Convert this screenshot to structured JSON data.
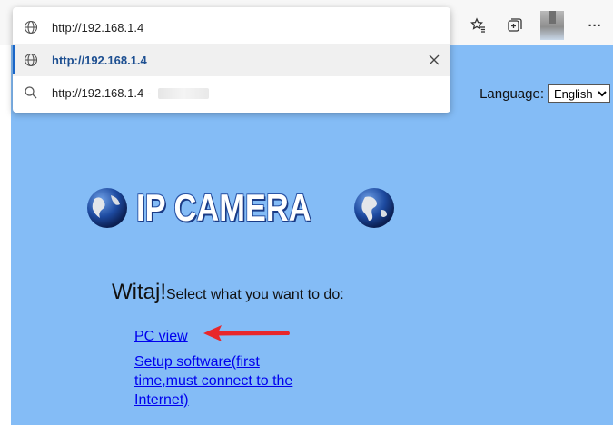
{
  "browser": {
    "favorites_icon": "favorites-star-icon",
    "collections_icon": "collections-icon",
    "more_icon": "more-dots-icon",
    "more_label": "···"
  },
  "address_dropdown": {
    "input_value": "http://192.168.1.4",
    "suggestion_url": "http://192.168.1.4",
    "search_suggestion": "http://192.168.1.4 -"
  },
  "page": {
    "language_label": "Language:",
    "language_selected": "English",
    "language_options": [
      "English"
    ],
    "banner_title": "IP CAMERA",
    "greeting": "Witaj!",
    "prompt": "Select what you want to do:",
    "links": {
      "pc_view": "PC view",
      "setup_software": "Setup software(first time,must connect to the Internet)"
    }
  },
  "colors": {
    "page_background": "#84bcf6",
    "link": "#0000ee",
    "annotation_arrow": "#e8272b",
    "selection_accent": "#1a66c8"
  }
}
